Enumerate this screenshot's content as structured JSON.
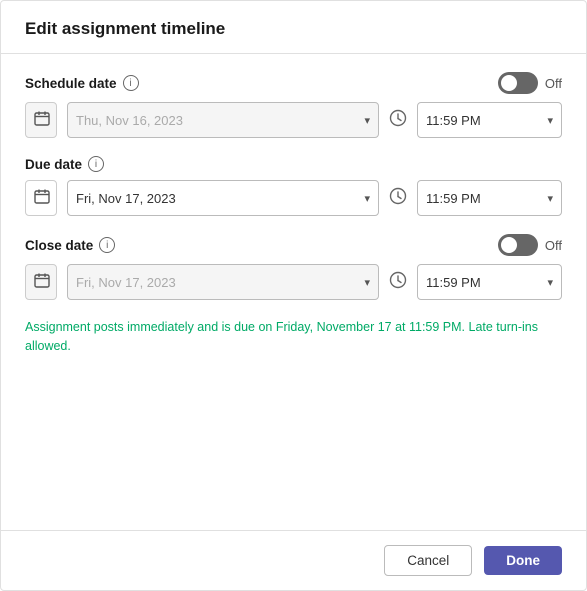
{
  "dialog": {
    "title": "Edit assignment timeline"
  },
  "schedule": {
    "label": "Schedule date",
    "toggle_label": "Off",
    "date_placeholder": "Thu, Nov 16, 2023",
    "time_value": "11:59 PM",
    "disabled": true
  },
  "due": {
    "label": "Due date",
    "date_value": "Fri, Nov 17, 2023",
    "time_value": "11:59 PM",
    "disabled": false
  },
  "close": {
    "label": "Close date",
    "toggle_label": "Off",
    "date_placeholder": "Fri, Nov 17, 2023",
    "time_value": "11:59 PM",
    "disabled": true
  },
  "summary": "Assignment posts immediately and is due on Friday, November 17 at 11:59 PM. Late turn-ins allowed.",
  "footer": {
    "cancel_label": "Cancel",
    "done_label": "Done"
  },
  "icons": {
    "info": "i",
    "calendar": "📅",
    "clock": "🕐",
    "chevron_down": "▾"
  }
}
